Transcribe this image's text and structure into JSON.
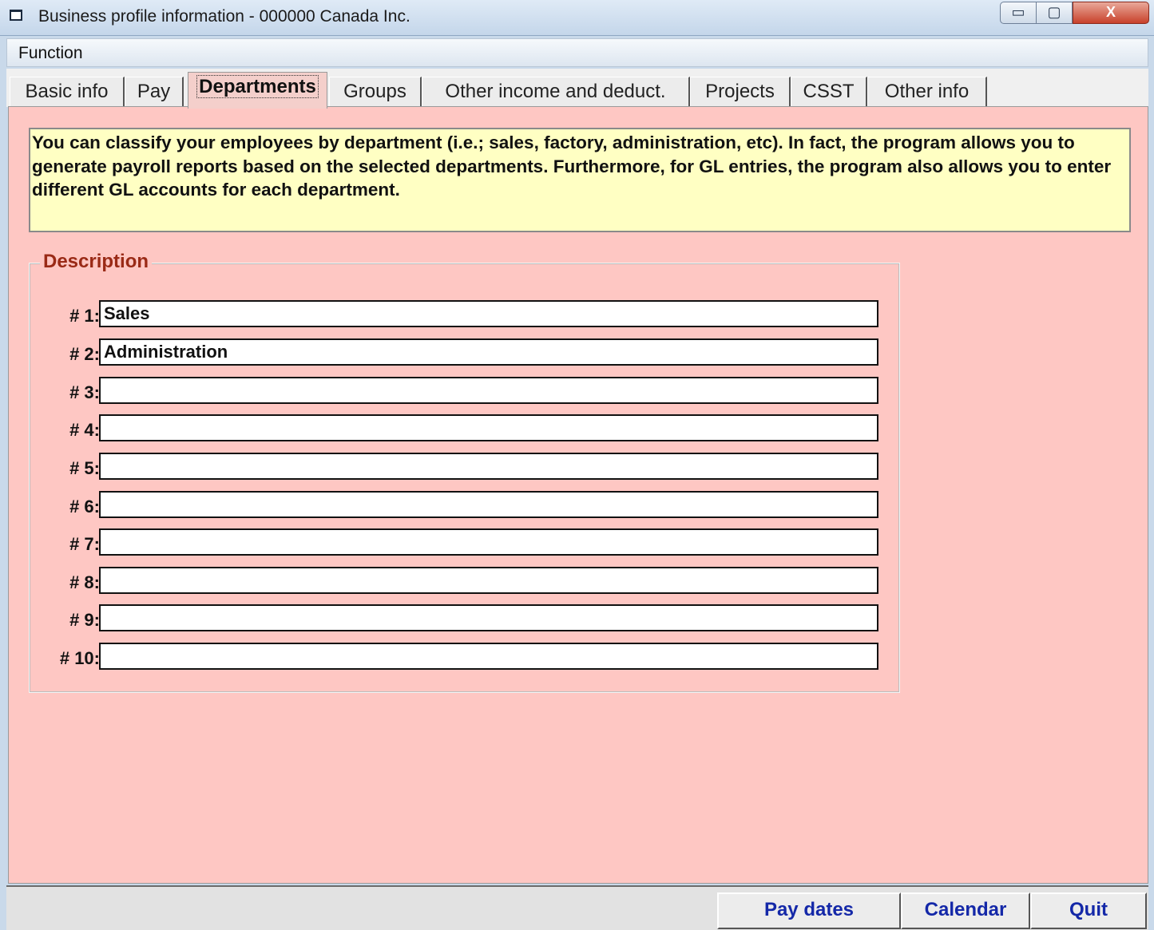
{
  "window": {
    "title": "Business profile information - 000000 Canada Inc.",
    "minimize": "▭",
    "maximize": "▢",
    "close": "X"
  },
  "menu": {
    "items": [
      "Function"
    ]
  },
  "tabs": [
    {
      "label": "Basic info",
      "active": false
    },
    {
      "label": "Pay",
      "active": false
    },
    {
      "label": "Departments",
      "active": true
    },
    {
      "label": "Groups",
      "active": false
    },
    {
      "label": "Other income and deduct.",
      "active": false
    },
    {
      "label": "Projects",
      "active": false
    },
    {
      "label": "CSST",
      "active": false
    },
    {
      "label": "Other info",
      "active": false
    }
  ],
  "info": {
    "text": "You can classify your employees by department (i.e.; sales, factory, administration, etc). In fact, the program allows you to generate payroll reports based on the selected departments. Furthermore, for GL entries, the program also allows you to enter different GL accounts for each department."
  },
  "description": {
    "legend": "Description",
    "rows": [
      {
        "label": "# 1:",
        "value": "Sales"
      },
      {
        "label": "# 2:",
        "value": "Administration"
      },
      {
        "label": "# 3:",
        "value": ""
      },
      {
        "label": "# 4:",
        "value": ""
      },
      {
        "label": "# 5:",
        "value": ""
      },
      {
        "label": "# 6:",
        "value": ""
      },
      {
        "label": "# 7:",
        "value": ""
      },
      {
        "label": "# 8:",
        "value": ""
      },
      {
        "label": "# 9:",
        "value": ""
      },
      {
        "label": "# 10:",
        "value": ""
      }
    ]
  },
  "buttons": {
    "pay_dates": "Pay dates",
    "calendar": "Calendar",
    "quit": "Quit"
  },
  "colors": {
    "page_background": "#fec7c3",
    "info_background": "#ffffc3",
    "legend_text": "#9a2a16",
    "button_text": "#1428a8"
  }
}
